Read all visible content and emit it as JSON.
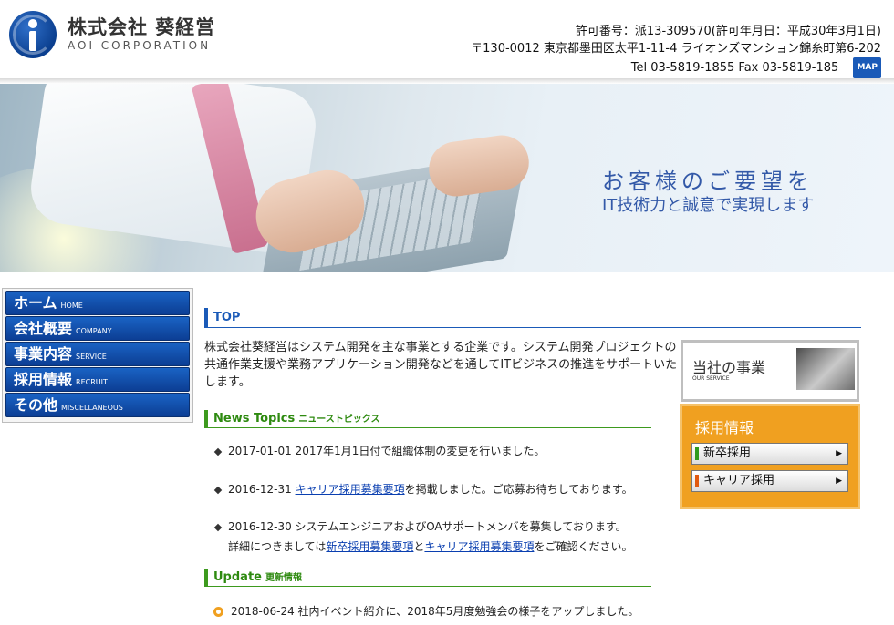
{
  "header": {
    "company_name": "株式会社 葵経営",
    "company_name_en": "AOI CORPORATION",
    "license": "許可番号：派13-309570(許可年月日：平成30年3月1日)",
    "address": "〒130-0012  東京都墨田区太平1-11-4 ライオンズマンション錦糸町第6-202",
    "phone_fax": "Tel 03-5819-1855 Fax 03-5819-185",
    "map_label": "MAP"
  },
  "hero": {
    "title": "お客様のご要望を",
    "subtitle": "IT技術力と誠意で実現します"
  },
  "sidebar": {
    "items": [
      {
        "jp": "ホーム",
        "en": "HOME"
      },
      {
        "jp": "会社概要",
        "en": "COMPANY"
      },
      {
        "jp": "事業内容",
        "en": "SERVICE"
      },
      {
        "jp": "採用情報",
        "en": "RECRUIT"
      },
      {
        "jp": "その他",
        "en": "MISCELLANEOUS"
      }
    ]
  },
  "main": {
    "heading": "TOP",
    "intro": "株式会社葵経営はシステム開発を主な事業とする企業です。システム開発プロジェクトの共通作業支援や業務アプリケーション開発などを通してITビジネスの推進をサポートいたします。",
    "news_heading": "News Topics",
    "news_heading_sub": "ニューストピックス",
    "news": [
      {
        "text": "2017-01-01 2017年1月1日付で組織体制の変更を行いました。"
      },
      {
        "pre": "2016-12-31 ",
        "link": "キャリア採用募集要項",
        "post": "を掲載しました。ご応募お待ちしております。"
      },
      {
        "line1": "2016-12-30 システムエンジニアおよびOAサポートメンバを募集しております。",
        "pre": "詳細につきましては",
        "link1": "新卒採用募集要項",
        "mid": "と",
        "link2": "キャリア採用募集要項",
        "post": "をご確認ください。"
      }
    ],
    "update_heading": "Update",
    "update_heading_sub": "更新情報",
    "updates": [
      "2018-06-24 社内イベント紹介に、2018年5月度勉強会の様子をアップしました。"
    ]
  },
  "service_box": {
    "label": "当社の事業",
    "label_en": "OUR SERVICE"
  },
  "recruit_box": {
    "title": "採用情報",
    "buttons": [
      {
        "label": "新卒採用",
        "color": "#2e9a1e"
      },
      {
        "label": "キャリア採用",
        "color": "#e05a10"
      }
    ]
  },
  "colors": {
    "accent_blue": "#1a5ab8",
    "accent_green": "#3d9a1e",
    "recruit_orange": "#f0a020"
  }
}
